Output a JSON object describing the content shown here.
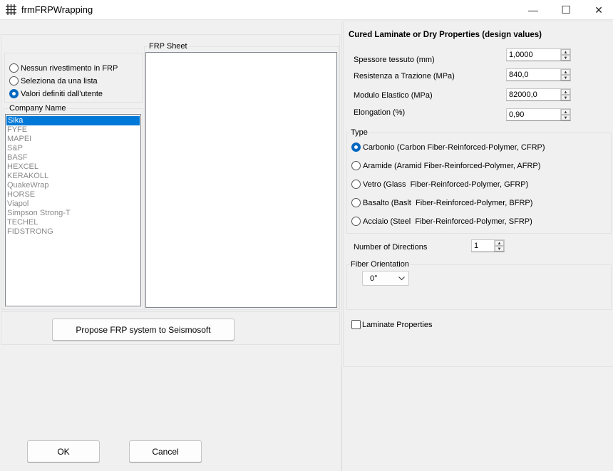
{
  "window": {
    "title": "frmFRPWrapping",
    "minimize_glyph": "—",
    "maximize_glyph": "☐",
    "close_glyph": "✕",
    "icon": "grid-app-icon"
  },
  "coating": {
    "options": [
      {
        "label": "Nessun rivestimento in FRP",
        "selected": false
      },
      {
        "label": "Seleziona da una lista",
        "selected": false
      },
      {
        "label": "Valori definiti dall'utente",
        "selected": true
      }
    ]
  },
  "company": {
    "group_label": "Company Name",
    "items": [
      "Sika",
      "FYFE",
      "MAPEI",
      "S&P",
      "BASF",
      "HEXCEL",
      "KERAKOLL",
      "QuakeWrap",
      "HORSE",
      "Viapol",
      "Simpson Strong-T",
      "TECHEL",
      "FIDSTRONG"
    ],
    "selected_index": 0
  },
  "frp_sheet": {
    "group_label": "FRP Sheet"
  },
  "propose_button": "Propose FRP system to Seismosoft",
  "properties": {
    "heading": "Cured Laminate or Dry Properties (design values)",
    "fields": [
      {
        "label": "Spessore tessuto (mm)",
        "value": "1,0000"
      },
      {
        "label": "Resistenza a Trazione (MPa)",
        "value": "840,0"
      },
      {
        "label": "Modulo Elastico (MPa)",
        "value": "82000,0"
      },
      {
        "label": "Elongation (%)",
        "value": "0,90"
      }
    ]
  },
  "type": {
    "group_label": "Type",
    "options": [
      {
        "label": "Carbonio (Carbon Fiber-Reinforced-Polymer, CFRP)",
        "selected": true
      },
      {
        "label": "Aramide (Aramid Fiber-Reinforced-Polymer, AFRP)",
        "selected": false
      },
      {
        "label": "Vetro (Glass  Fiber-Reinforced-Polymer, GFRP)",
        "selected": false
      },
      {
        "label": "Basalto (Baslt  Fiber-Reinforced-Polymer, BFRP)",
        "selected": false
      },
      {
        "label": "Acciaio (Steel  Fiber-Reinforced-Polymer, SFRP)",
        "selected": false
      }
    ]
  },
  "directions": {
    "label": "Number of Directions",
    "value": "1"
  },
  "orientation": {
    "group_label": "Fiber Orientation",
    "value": "0°"
  },
  "laminate": {
    "label": "Laminate Properties",
    "checked": false
  },
  "footer": {
    "ok_label": "OK",
    "cancel_label": "Cancel"
  }
}
